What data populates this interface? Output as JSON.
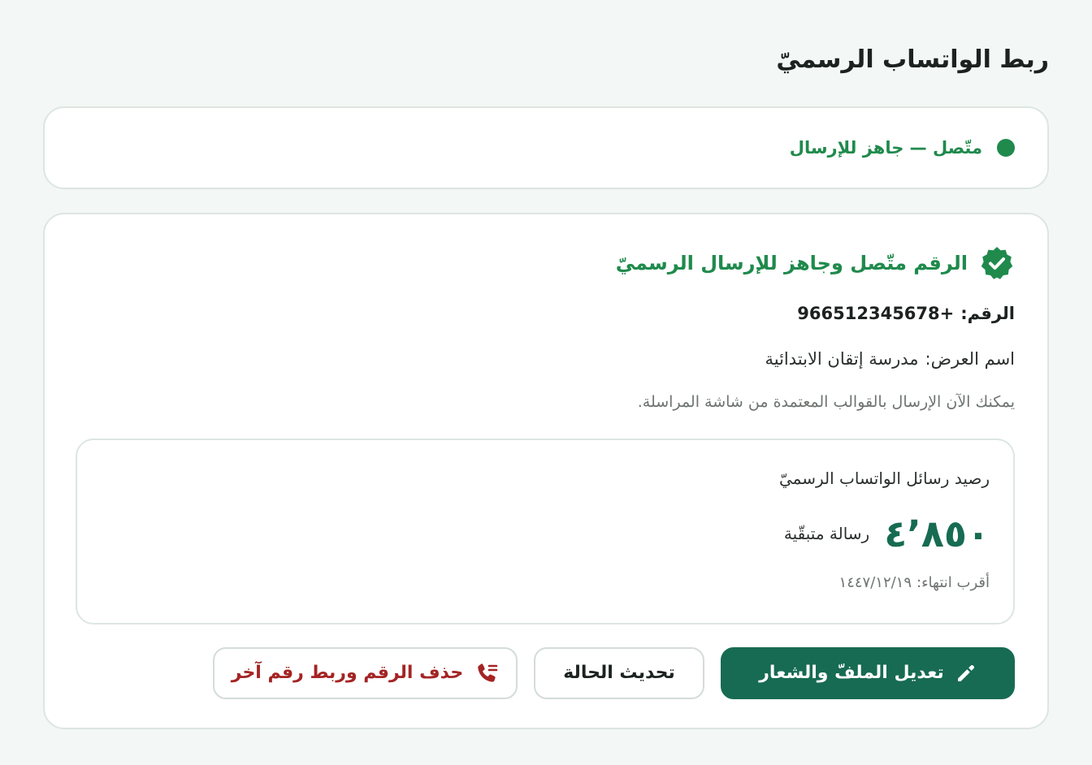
{
  "page": {
    "title": "ربط الواتساب الرسميّ"
  },
  "status": {
    "text": "متّصل — جاهز للإرسال",
    "color": "#1f8a4c"
  },
  "details": {
    "verified_text": "الرقم متّصل وجاهز للإرسال الرسميّ",
    "phone_label": "الرقم:",
    "phone_value": "966512345678+",
    "display_name_label": "اسم العرض:",
    "display_name_value": "مدرسة إتقان الابتدائية",
    "hint": "يمكنك الآن الإرسال بالقوالب المعتمدة من شاشة المراسلة."
  },
  "balance": {
    "title": "رصيد رسائل الواتساب الرسميّ",
    "count": "٤٬٨٥٠",
    "unit": "رسالة متبقّية",
    "expiry_label": "أقرب انتهاء:",
    "expiry_value": "١٤٤٧/١٢/١٩"
  },
  "actions": {
    "edit_profile_label": "تعديل الملفّ والشعار",
    "refresh_label": "تحديث الحالة",
    "delete_label": "حذف الرقم وربط رقم آخر"
  },
  "icons": {
    "verified": "verified-badge-icon",
    "edit": "pencil-icon",
    "delete": "phone-disconnect-icon"
  },
  "colors": {
    "accent": "#176b52",
    "success": "#1f8a4c",
    "danger": "#a42424",
    "background": "#f3f7f5"
  }
}
